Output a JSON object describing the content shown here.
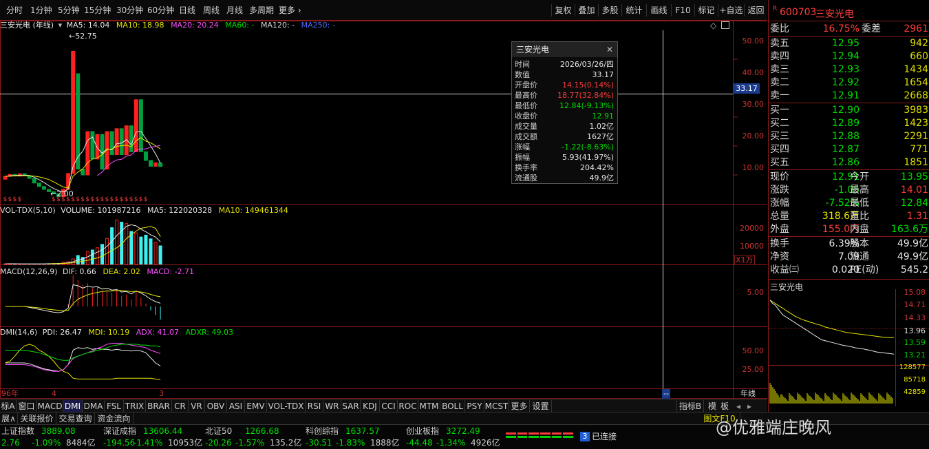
{
  "periods": [
    "分时",
    "1分钟",
    "5分钟",
    "15分钟",
    "30分钟",
    "60分钟",
    "日线",
    "周线",
    "月线",
    "多周期",
    "更多"
  ],
  "toolbar": [
    "复权",
    "叠加",
    "多股",
    "统计",
    "画线",
    "F10",
    "标记",
    "+自选",
    "返回"
  ],
  "main_legend": {
    "name": "三安光电 (年线)",
    "ma5": "MA5: 14.04",
    "ma10": "MA10: 18.98",
    "ma20": "MA20: 20.24",
    "ma60": "MA60: -",
    "ma120": "MA120: -",
    "ma250": "MA250: -"
  },
  "price_labels": {
    "high": "52.75",
    "low": "2.00",
    "cursor": "33.17"
  },
  "price_axis": [
    "50.00",
    "40.00",
    "30.00",
    "20.00",
    "10.00"
  ],
  "vol_legend": {
    "name": "VOL-TDX(5,10)",
    "volume": "VOLUME: 101987216",
    "ma5": "MA5: 122020328",
    "ma10": "MA10: 149461344"
  },
  "vol_axis": [
    "20000",
    "10000"
  ],
  "vol_unit": "X1万",
  "macd_legend": {
    "name": "MACD(12,26,9)",
    "dif": "DIF: 0.66",
    "dea": "DEA: 2.02",
    "macd": "MACD: -2.71"
  },
  "macd_axis": [
    "5.00"
  ],
  "dmi_legend": {
    "name": "DMI(14,6)",
    "pdi": "PDI: 26.47",
    "mdi": "MDI: 10.19",
    "adx": "ADX: 41.07",
    "adxr": "ADXR: 49.03"
  },
  "dmi_axis": [
    "50.00",
    "25.00"
  ],
  "x_labels": {
    "start": "96年",
    "mid": "4",
    "end": "3",
    "cursor": "--",
    "period": "年线"
  },
  "tooltip": {
    "title": "三安光电",
    "rows": [
      {
        "k": "时间",
        "v": "2026/03/26/四",
        "c": "white"
      },
      {
        "k": "数值",
        "v": "33.17",
        "c": "white"
      },
      {
        "k": "开盘价",
        "v": "14.15(0.14%)",
        "c": "red"
      },
      {
        "k": "最高价",
        "v": "18.77(32.84%)",
        "c": "red"
      },
      {
        "k": "最低价",
        "v": "12.84(-9.13%)",
        "c": "green"
      },
      {
        "k": "收盘价",
        "v": "12.91",
        "c": "green"
      },
      {
        "k": "成交量",
        "v": "1.02亿",
        "c": "white"
      },
      {
        "k": "成交额",
        "v": "1627亿",
        "c": "white"
      },
      {
        "k": "涨幅",
        "v": "-1.22(-8.63%)",
        "c": "green"
      },
      {
        "k": "振幅",
        "v": "5.93(41.97%)",
        "c": "white"
      },
      {
        "k": "换手率",
        "v": "204.42%",
        "c": "white"
      },
      {
        "k": "流通股",
        "v": "49.9亿",
        "c": "white"
      }
    ]
  },
  "quote": {
    "badge": "R",
    "code": "600703",
    "name": "三安光电",
    "weibi": {
      "k": "委比",
      "v": "16.75%",
      "k2": "委差",
      "v2": "2961"
    },
    "asks": [
      {
        "k": "卖五",
        "p": "12.95",
        "v": "942"
      },
      {
        "k": "卖四",
        "p": "12.94",
        "v": "660"
      },
      {
        "k": "卖三",
        "p": "12.93",
        "v": "1434"
      },
      {
        "k": "卖二",
        "p": "12.92",
        "v": "1654"
      },
      {
        "k": "卖一",
        "p": "12.91",
        "v": "2668"
      }
    ],
    "bids": [
      {
        "k": "买一",
        "p": "12.90",
        "v": "3983"
      },
      {
        "k": "买二",
        "p": "12.89",
        "v": "1423"
      },
      {
        "k": "买三",
        "p": "12.88",
        "v": "2291"
      },
      {
        "k": "买四",
        "p": "12.87",
        "v": "771"
      },
      {
        "k": "买五",
        "p": "12.86",
        "v": "1851"
      }
    ],
    "stats": [
      {
        "k": "现价",
        "v": "12.91",
        "c": "green",
        "k2": "今开",
        "v2": "13.95",
        "c2": "green"
      },
      {
        "k": "涨跌",
        "v": "-1.05",
        "c": "green",
        "k2": "最高",
        "v2": "14.01",
        "c2": "red"
      },
      {
        "k": "涨幅",
        "v": "-7.52%",
        "c": "green",
        "k2": "最低",
        "v2": "12.84",
        "c2": "green"
      },
      {
        "k": "总量",
        "v": "318.6万",
        "c": "yellow",
        "k2": "量比",
        "v2": "1.31",
        "c2": "red"
      },
      {
        "k": "外盘",
        "v": "155.0万",
        "c": "red",
        "k2": "内盘",
        "v2": "163.6万",
        "c2": "green"
      }
    ],
    "stats2": [
      {
        "k": "换手",
        "v": "6.39%",
        "c": "white",
        "k2": "股本",
        "v2": "49.9亿",
        "c2": "white"
      },
      {
        "k": "净资",
        "v": "7.09",
        "c": "white",
        "k2": "流通",
        "v2": "49.9亿",
        "c2": "white"
      },
      {
        "k": "收益㈢",
        "v": "0.020",
        "c": "white",
        "k2": "PE(动)",
        "v2": "545.2",
        "c2": "white"
      }
    ],
    "mini_title": "三安光电",
    "mini_axis": [
      "15.08",
      "14.71",
      "14.33",
      "13.96",
      "13.59",
      "13.21"
    ],
    "mini_vol_axis": [
      "128577",
      "85718",
      "42859"
    ]
  },
  "tabs": [
    "标A",
    "窗口",
    "MACD",
    "DMI",
    "DMA",
    "FSL",
    "TRIX",
    "BRAR",
    "CR",
    "VR",
    "OBV",
    "ASI",
    "EMV",
    "VOL-TDX",
    "RSI",
    "WR",
    "SAR",
    "KDJ",
    "CCI",
    "ROC",
    "MTM",
    "BOLL",
    "PSY",
    "MCST",
    "更多",
    "设置"
  ],
  "tabs_right": [
    "指标B",
    "模",
    "板"
  ],
  "nav": [
    "展∧",
    "关联报价",
    "交易查询",
    "资金流向"
  ],
  "nav_right": "图文F10",
  "indices": [
    {
      "name": "上证指数",
      "val": "3889.08",
      "chg": "2.76",
      "pct": "-1.09%",
      "amt": "8484亿"
    },
    {
      "name": "深证成指",
      "val": "13606.44",
      "chg": "-194.56",
      "pct": "-1.41%",
      "amt": "10953亿"
    },
    {
      "name": "北证50",
      "val": "1266.68",
      "chg": "-20.26",
      "pct": "-1.57%",
      "amt": "135.2亿"
    },
    {
      "name": "科创综指",
      "val": "1637.57",
      "chg": "-30.51",
      "pct": "-1.83%",
      "amt": "1888亿"
    },
    {
      "name": "创业板指",
      "val": "3272.49",
      "chg": "-44.48",
      "pct": "-1.34%",
      "amt": "4926亿"
    }
  ],
  "conn": {
    "num": "3",
    "text": "已连接"
  },
  "watermark": "@优雅端庄晚风",
  "chart_data": {
    "type": "candlestick",
    "title": "三安光电 (年线)",
    "candles": [
      {
        "o": 8.5,
        "c": 9.5
      },
      {
        "o": 9.5,
        "c": 10.2
      },
      {
        "o": 10.2,
        "c": 9.6
      },
      {
        "o": 9.6,
        "c": 10.4
      },
      {
        "o": 10.4,
        "c": 9.8
      },
      {
        "o": 9.8,
        "c": 8.8
      },
      {
        "o": 8.8,
        "c": 7.2
      },
      {
        "o": 7.2,
        "c": 6.0
      },
      {
        "o": 6.0,
        "c": 5.0
      },
      {
        "o": 5.0,
        "c": 4.2
      },
      {
        "o": 4.2,
        "c": 3.5
      },
      {
        "o": 3.5,
        "c": 2.5
      },
      {
        "o": 2.5,
        "c": 5.0
      },
      {
        "o": 5.0,
        "c": 10.5
      },
      {
        "o": 10.5,
        "c": 52.75
      },
      {
        "o": 45.0,
        "c": 12.0
      },
      {
        "o": 12.0,
        "c": 10.0
      },
      {
        "o": 10.0,
        "c": 25.0
      },
      {
        "o": 25.0,
        "c": 15.5
      },
      {
        "o": 15.5,
        "c": 24.0
      },
      {
        "o": 24.0,
        "c": 12.0
      },
      {
        "o": 12.0,
        "c": 25.0
      },
      {
        "o": 25.0,
        "c": 17.0
      },
      {
        "o": 17.0,
        "c": 26.0
      },
      {
        "o": 26.0,
        "c": 17.0
      },
      {
        "o": 17.0,
        "c": 27.0
      },
      {
        "o": 27.0,
        "c": 18.0
      },
      {
        "o": 18.0,
        "c": 36.0
      },
      {
        "o": 36.0,
        "c": 18.0
      },
      {
        "o": 18.0,
        "c": 15.0
      },
      {
        "o": 15.0,
        "c": 13.0
      },
      {
        "o": 13.0,
        "c": 14.2
      },
      {
        "o": 14.15,
        "c": 12.91
      }
    ],
    "ma5": [
      9.5,
      9.7,
      9.8,
      9.9,
      9.9,
      9.8,
      9.2,
      8.3,
      7.4,
      6.3,
      5.3,
      4.6,
      4.1,
      5.1,
      13.0,
      16.3,
      18.2,
      22.0,
      23.1,
      19.3,
      17.5,
      19.0,
      18.7,
      20.8,
      21.0,
      22.2,
      20.4,
      24.8,
      25.0,
      22.6,
      20.0,
      17.3,
      14.04
    ],
    "ma10": [
      9.5,
      9.6,
      9.7,
      9.7,
      9.7,
      9.7,
      9.6,
      9.3,
      8.9,
      8.4,
      7.6,
      6.7,
      5.8,
      5.5,
      9.6,
      11.0,
      12.1,
      14.2,
      15.5,
      15.9,
      17.0,
      18.8,
      18.9,
      19.9,
      20.1,
      20.3,
      19.7,
      21.8,
      22.9,
      21.7,
      21.1,
      20.1,
      18.98
    ],
    "ma20": [
      null,
      null,
      null,
      null,
      null,
      null,
      null,
      null,
      null,
      null,
      null,
      null,
      null,
      null,
      null,
      null,
      null,
      null,
      null,
      9.8,
      11.0,
      12.9,
      14.3,
      15.2,
      15.4,
      16.5,
      16.9,
      18.5,
      19.0,
      19.0,
      19.6,
      19.8,
      20.24
    ],
    "volume": [
      300,
      400,
      350,
      300,
      320,
      280,
      350,
      400,
      380,
      500,
      600,
      700,
      1200,
      1500,
      3000,
      5000,
      4000,
      7000,
      8000,
      9000,
      11000,
      14000,
      20000,
      24000,
      23000,
      22000,
      18000,
      17000,
      15000,
      16000,
      14000,
      12000,
      10199
    ],
    "vol_ma5": [
      350,
      370,
      370,
      340,
      330,
      330,
      340,
      330,
      340,
      400,
      470,
      550,
      680,
      900,
      1460,
      2460,
      2940,
      4100,
      5400,
      6600,
      7800,
      9800,
      12400,
      15600,
      18000,
      20600,
      21400,
      20800,
      19000,
      17600,
      16000,
      14800,
      12202
    ],
    "vol_ma10": [
      null,
      null,
      null,
      null,
      null,
      null,
      null,
      null,
      null,
      360,
      400,
      440,
      520,
      650,
      900,
      1400,
      1700,
      2200,
      2900,
      3500,
      4500,
      6000,
      7500,
      9000,
      11000,
      14000,
      16000,
      18000,
      19500,
      20000,
      20500,
      19500,
      14946
    ],
    "macd": [
      0,
      0,
      0,
      0,
      0,
      0,
      0,
      0,
      0,
      0,
      0,
      0,
      0,
      0.5,
      6.5,
      5.5,
      4.5,
      4.8,
      3.8,
      4.0,
      3.0,
      3.5,
      2.8,
      3.2,
      2.2,
      2.5,
      1.5,
      3.0,
      1.8,
      0.6,
      -0.8,
      -1.8,
      -2.71
    ],
    "dif": [
      0,
      0,
      0,
      0,
      0,
      -0.2,
      -0.4,
      -0.6,
      -0.8,
      -1.0,
      -1.2,
      -1.3,
      -1.1,
      -0.3,
      4.5,
      4.3,
      3.8,
      4.2,
      4.0,
      4.1,
      3.6,
      3.8,
      3.4,
      3.5,
      3.0,
      3.1,
      2.6,
      3.2,
      2.8,
      2.2,
      1.5,
      1.0,
      0.66
    ],
    "dea": [
      0,
      0,
      0,
      0,
      0,
      -0.1,
      -0.2,
      -0.3,
      -0.4,
      -0.6,
      -0.7,
      -0.8,
      -0.9,
      -0.8,
      0.6,
      1.5,
      2.0,
      2.4,
      2.7,
      2.9,
      3.1,
      3.2,
      3.2,
      3.3,
      3.3,
      3.2,
      3.1,
      3.1,
      3.0,
      2.8,
      2.5,
      2.2,
      2.02
    ],
    "pdi": [
      30,
      30,
      30,
      30,
      30,
      29,
      27,
      25,
      23,
      22,
      21,
      20,
      22,
      28,
      45,
      48,
      47,
      48,
      46,
      47,
      46,
      46,
      45,
      46,
      45,
      45,
      44,
      45,
      44,
      42,
      36,
      30,
      26.47
    ],
    "mdi": [
      30,
      32,
      38,
      45,
      50,
      52,
      50,
      45,
      42,
      38,
      32,
      25,
      20,
      18,
      12,
      11,
      11,
      11,
      11,
      11,
      11,
      11,
      11,
      12,
      12,
      12,
      12,
      12,
      12,
      12,
      12,
      11,
      10.19
    ],
    "adx": [
      28,
      28,
      28,
      28,
      28,
      27,
      26,
      24,
      22,
      21,
      20,
      20,
      22,
      28,
      35,
      38,
      40,
      42,
      44,
      47,
      49,
      52,
      53,
      53,
      53,
      52,
      51,
      50,
      49,
      48,
      45,
      43,
      41.07
    ],
    "adxr": [
      45,
      45,
      45,
      45,
      45,
      44,
      43,
      42,
      40,
      38,
      36,
      34,
      33,
      33,
      36,
      38,
      40,
      42,
      43,
      45,
      46,
      48,
      50,
      51,
      52,
      52,
      52,
      52,
      51,
      51,
      50,
      50,
      49.03
    ],
    "price_ylim": [
      0,
      60
    ],
    "vol_ylim": [
      0,
      26000
    ],
    "dmi_ylim": [
      0,
      60
    ],
    "mini_line": [
      14.95,
      14.85,
      14.8,
      14.7,
      14.6,
      14.5,
      14.45,
      14.4,
      14.35,
      14.3,
      14.25,
      14.2,
      14.15,
      14.1,
      14.05,
      14.0,
      13.95,
      13.9,
      13.85,
      13.8,
      13.75,
      13.72,
      13.7,
      13.68,
      13.66,
      13.64,
      13.62,
      13.6,
      13.58,
      13.56,
      13.55,
      13.53,
      13.52,
      13.5,
      13.48,
      13.47,
      13.46,
      13.45,
      13.43,
      13.42,
      13.4,
      13.38,
      13.36,
      13.35,
      13.34,
      13.33,
      13.32,
      13.31,
      13.3,
      13.29
    ],
    "mini_avg": [
      14.95,
      14.9,
      14.85,
      14.8,
      14.75,
      14.7,
      14.65,
      14.6,
      14.55,
      14.5,
      14.45,
      14.42,
      14.38,
      14.35,
      14.32,
      14.3,
      14.27,
      14.25,
      14.22,
      14.2,
      14.18,
      14.15,
      14.12,
      14.1,
      14.08,
      14.06,
      14.04,
      14.02,
      14.0,
      13.98,
      13.96,
      13.95,
      13.94,
      13.93,
      13.92,
      13.91,
      13.9,
      13.89,
      13.88,
      13.87,
      13.86,
      13.85,
      13.84,
      13.83,
      13.82,
      13.81,
      13.81,
      13.8,
      13.8,
      13.8
    ],
    "mini_ylim": [
      13.0,
      15.2
    ]
  }
}
